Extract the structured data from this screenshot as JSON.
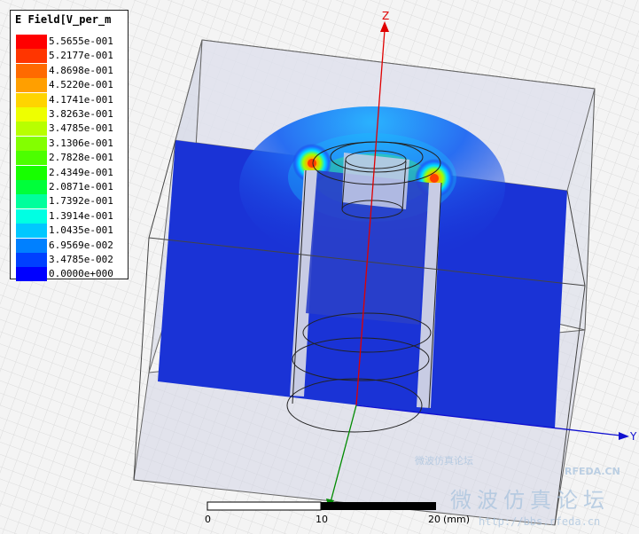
{
  "legend": {
    "title": "E Field[V_per_m",
    "items": [
      {
        "value": "5.5655e-001",
        "color": "#ff0000"
      },
      {
        "value": "5.2177e-001",
        "color": "#ff3500"
      },
      {
        "value": "4.8698e-001",
        "color": "#ff6a00"
      },
      {
        "value": "4.5220e-001",
        "color": "#ff9f00"
      },
      {
        "value": "4.1741e-001",
        "color": "#ffd400"
      },
      {
        "value": "3.8263e-001",
        "color": "#eeff00"
      },
      {
        "value": "3.4785e-001",
        "color": "#b8ff00"
      },
      {
        "value": "3.1306e-001",
        "color": "#83ff00"
      },
      {
        "value": "2.7828e-001",
        "color": "#4cff00"
      },
      {
        "value": "2.4349e-001",
        "color": "#17ff00"
      },
      {
        "value": "2.0871e-001",
        "color": "#00ff3a"
      },
      {
        "value": "1.7392e-001",
        "color": "#00ff9c"
      },
      {
        "value": "1.3914e-001",
        "color": "#00ffe3"
      },
      {
        "value": "1.0435e-001",
        "color": "#00c8ff"
      },
      {
        "value": "6.9569e-002",
        "color": "#0080ff"
      },
      {
        "value": "3.4785e-002",
        "color": "#0040ff"
      },
      {
        "value": "0.0000e+000",
        "color": "#0000ff"
      }
    ]
  },
  "axes": {
    "z": "Z",
    "y": "Y"
  },
  "scale": {
    "ticks": [
      "0",
      "10",
      "20"
    ],
    "unit": "(mm)"
  },
  "watermark": {
    "line1": "微波仿真论坛",
    "line2": "http://bbs.rfeda.cn",
    "brand": "RFEDA.CN",
    "cn_small": "微波仿真论坛"
  },
  "colors": {
    "field_low": "#1a33d6",
    "box_fill": "#c9cfe6",
    "axis_z": "#e00000",
    "axis_y": "#1010d0",
    "axis_x": "#008a00"
  }
}
